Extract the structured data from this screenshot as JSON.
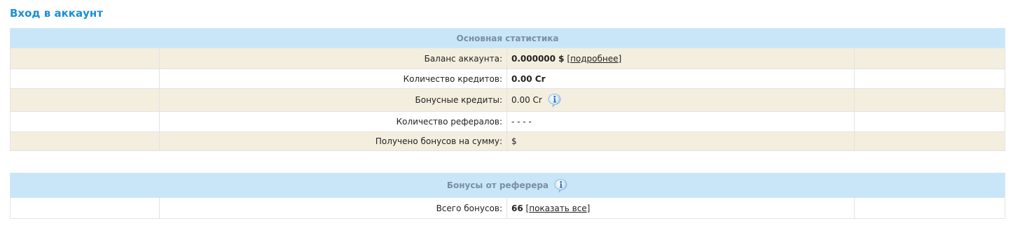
{
  "page": {
    "title": "Вход в аккаунт"
  },
  "main_stats": {
    "header": "Основная статистика",
    "rows": [
      {
        "label": "Баланс аккаунта:",
        "value": "0.000000 $",
        "link": "подробнее"
      },
      {
        "label": "Количество кредитов:",
        "value": "0.00 Cr"
      },
      {
        "label": "Бонусные кредиты:",
        "value": "0.00 Cr",
        "icon": "info-icon"
      },
      {
        "label": "Количество рефералов:",
        "value": "- - - -"
      },
      {
        "label": "Получено бонусов на сумму:",
        "value": "$"
      }
    ]
  },
  "referrer_bonuses": {
    "header": "Бонусы от реферера",
    "header_icon": "info-icon",
    "rows": [
      {
        "label": "Всего бонусов:",
        "value": "66",
        "link": "показать все"
      }
    ]
  },
  "colors": {
    "title": "#1a8fd6",
    "header_bg": "#c8e6f8",
    "header_text": "#7b8fa3",
    "row_alt_bg": "#f3eede"
  }
}
